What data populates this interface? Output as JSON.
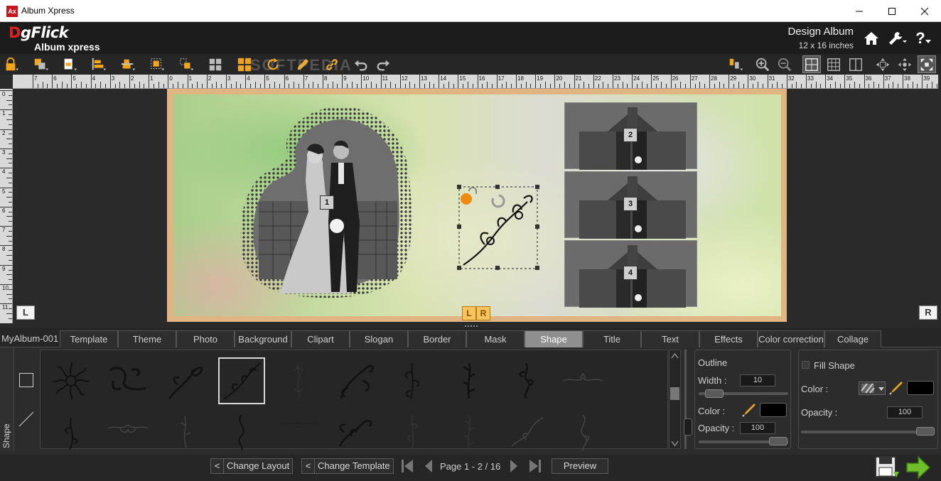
{
  "window": {
    "title": "Album Xpress",
    "app_icon_text": "Ax"
  },
  "header": {
    "brand": "DgFlick",
    "brand_first": "D",
    "brand_rest": "gFlick",
    "product": "Album xpress",
    "mode": "Design Album",
    "size": "12 x 16 inches",
    "help_label": "?"
  },
  "toolbar": {
    "watermark": "SOFTPEDIA"
  },
  "rulers": {
    "horizontal": [
      "7",
      "6",
      "5",
      "4",
      "3",
      "2",
      "1",
      "0",
      "1",
      "2",
      "3",
      "4",
      "5",
      "6",
      "7",
      "8",
      "9",
      "10",
      "11",
      "12",
      "13",
      "14",
      "15",
      "16",
      "17",
      "18",
      "19",
      "20",
      "21",
      "22",
      "23",
      "24",
      "25",
      "26",
      "27",
      "28",
      "29",
      "30",
      "31",
      "32",
      "33",
      "34",
      "35",
      "36",
      "37",
      "38",
      "39"
    ],
    "vertical": [
      "0",
      "1",
      "2",
      "3",
      "4",
      "5",
      "6",
      "7",
      "8",
      "9",
      "10",
      "11"
    ]
  },
  "canvas": {
    "photos": [
      {
        "number": "1"
      },
      {
        "number": "2"
      },
      {
        "number": "3"
      },
      {
        "number": "4"
      }
    ],
    "corner_left": "L",
    "corner_right": "R",
    "tab_l": "L",
    "tab_r": "R"
  },
  "tabs": {
    "album_name": "MyAlbum-001",
    "items": [
      "Template",
      "Theme",
      "Photo",
      "Background",
      "Clipart",
      "Slogan",
      "Border",
      "Mask",
      "Shape",
      "Title",
      "Text",
      "Effects",
      "Color correction",
      "Collage"
    ],
    "active": "Shape"
  },
  "shape_panel": {
    "side_label": "Shape",
    "outline": {
      "title": "Outline",
      "width_label": "Width :",
      "width_value": "10",
      "color_label": "Color :",
      "color_value": "#000000",
      "opacity_label": "Opacity :",
      "opacity_value": "100"
    },
    "fill": {
      "title": "Fill Shape",
      "color_label": "Color :",
      "color_value": "#000000",
      "opacity_label": "Opacity :",
      "opacity_value": "100"
    }
  },
  "bottom": {
    "change_layout": "Change Layout",
    "change_template": "Change Template",
    "prev_glyph": "<",
    "page_info": "Page 1 - 2 / 16",
    "preview": "Preview"
  },
  "colors": {
    "accent_orange": "#f6c35e",
    "next_green": "#6fbf2a",
    "page_border": "#e0b581"
  }
}
